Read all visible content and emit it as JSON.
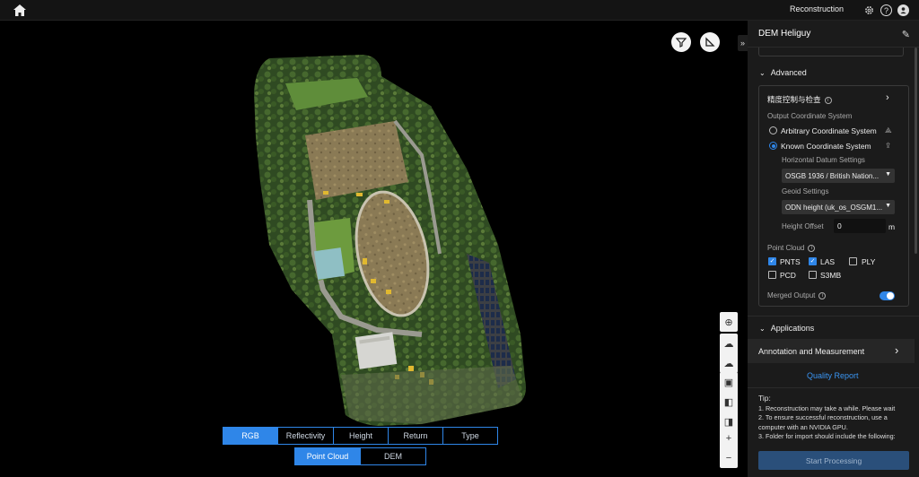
{
  "topbar": {
    "title": "Reconstruction"
  },
  "panel": {
    "title": "DEM Heliguy",
    "advanced_label": "Advanced",
    "precision_label": "精度控制与检查",
    "output_coord_label": "Output Coordinate System",
    "arbitrary_label": "Arbitrary Coordinate System",
    "known_label": "Known Coordinate System",
    "horizontal_datum_label": "Horizontal Datum Settings",
    "horizontal_datum_value": "OSGB 1936 / British Nation...",
    "geoid_label": "Geoid Settings",
    "geoid_value": "ODN height (uk_os_OSGM1...",
    "height_offset_label": "Height Offset",
    "height_offset_value": "0",
    "height_offset_unit": "m",
    "point_cloud_label": "Point Cloud",
    "formats": [
      {
        "label": "PNTS",
        "checked": true
      },
      {
        "label": "LAS",
        "checked": true
      },
      {
        "label": "PLY",
        "checked": false
      },
      {
        "label": "PCD",
        "checked": false
      },
      {
        "label": "S3MB",
        "checked": false
      }
    ],
    "merged_output_label": "Merged Output",
    "merged_output_on": true,
    "applications_label": "Applications",
    "annotation_label": "Annotation and Measurement",
    "quality_report_label": "Quality Report",
    "tip_title": "Tip:",
    "tip_1": "1. Reconstruction may take a while. Please wait",
    "tip_2a": "2. To ensure successful reconstruction, use a",
    "tip_2b": "computer with an NVIDIA GPU.",
    "tip_3": "3. Folder for import should include the following:",
    "start_label": "Start Processing"
  },
  "view_modes": [
    "RGB",
    "Reflectivity",
    "Height",
    "Return",
    "Type"
  ],
  "view_mode_active": "RGB",
  "data_modes": [
    "Point Cloud",
    "DEM"
  ],
  "data_mode_active": "Point Cloud",
  "colors": {
    "accent": "#2f86e8",
    "panel_bg": "#1b1b1b",
    "topbar_bg": "#141414"
  },
  "icons": [
    "home-icon",
    "settings-icon",
    "help-icon",
    "user-icon",
    "filter-icon",
    "measure-icon",
    "pencil-icon"
  ]
}
